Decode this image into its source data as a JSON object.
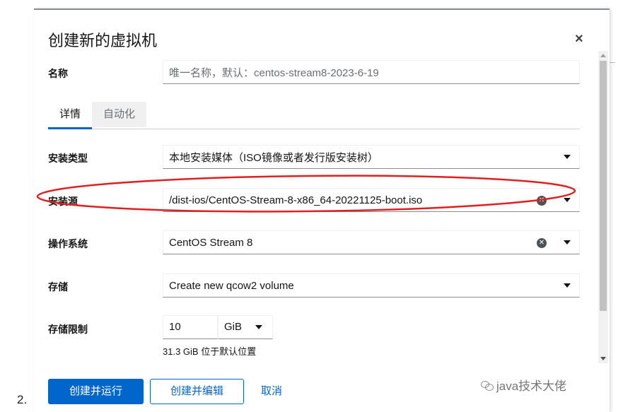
{
  "list_number": "2.",
  "dialog": {
    "title": "创建新的虚拟机",
    "close_symbol": "×"
  },
  "name": {
    "label": "名称",
    "placeholder": "唯一名称，默认：centos-stream8-2023-6-19"
  },
  "tabs": [
    {
      "label": "详情",
      "active": true
    },
    {
      "label": "自动化",
      "active": false
    }
  ],
  "install_type": {
    "label": "安装类型",
    "value": "本地安装媒体（ISO镜像或者发行版安装树）"
  },
  "install_source": {
    "label": "安装源",
    "value": "/dist-ios/CentOS-Stream-8-x86_64-20221125-boot.iso",
    "annotation_color": "#e02020"
  },
  "os": {
    "label": "操作系统",
    "value": "CentOS Stream 8"
  },
  "storage": {
    "label": "存储",
    "value": "Create new qcow2 volume"
  },
  "storage_limit": {
    "label": "存储限制",
    "value": "10",
    "unit": "GiB",
    "helper": "31.3 GiB 位于默认位置"
  },
  "buttons": {
    "create_run": "创建并运行",
    "create_edit": "创建并编辑",
    "cancel": "取消"
  },
  "watermark": "java技术大佬",
  "colors": {
    "primary": "#0066cc",
    "text": "#151515"
  }
}
